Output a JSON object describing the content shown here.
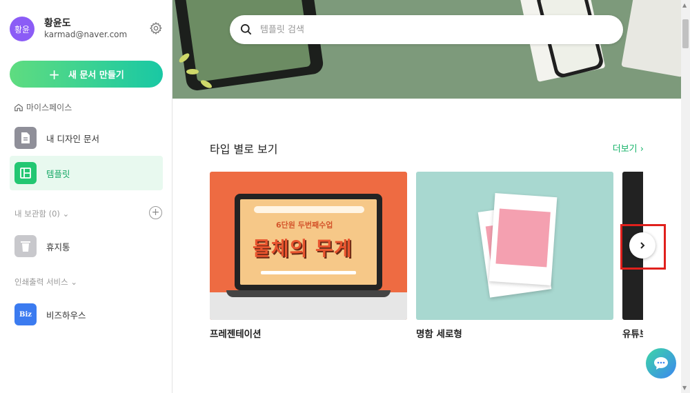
{
  "profile": {
    "avatar_text": "황윤",
    "name": "황윤도",
    "email": "karmad@naver.com"
  },
  "sidebar": {
    "new_doc_label": "새 문서 만들기",
    "workspace_label": "마이스페이스",
    "items": [
      {
        "label": "내 디자인 문서",
        "icon": "document-icon"
      },
      {
        "label": "템플릿",
        "icon": "template-icon"
      }
    ],
    "storage_label": "내 보관함 (0)",
    "trash_label": "휴지통",
    "print_label": "인쇄출력 서비스",
    "biz_label": "비즈하우스",
    "biz_icon_text": "Biz"
  },
  "search": {
    "placeholder": "템플릿 검색"
  },
  "section": {
    "title": "타입 별로 보기",
    "more": "더보기"
  },
  "cards": [
    {
      "caption": "프레젠테이션"
    },
    {
      "caption": "명함 세로형"
    },
    {
      "caption": "유튜브"
    }
  ],
  "presentation_thumb": {
    "subtitle": "6단원 두번째수업",
    "main": "물체의 무게"
  },
  "colors": {
    "accent": "#17b36a",
    "avatar": "#8b5cf6",
    "highlight": "#e0201c"
  }
}
